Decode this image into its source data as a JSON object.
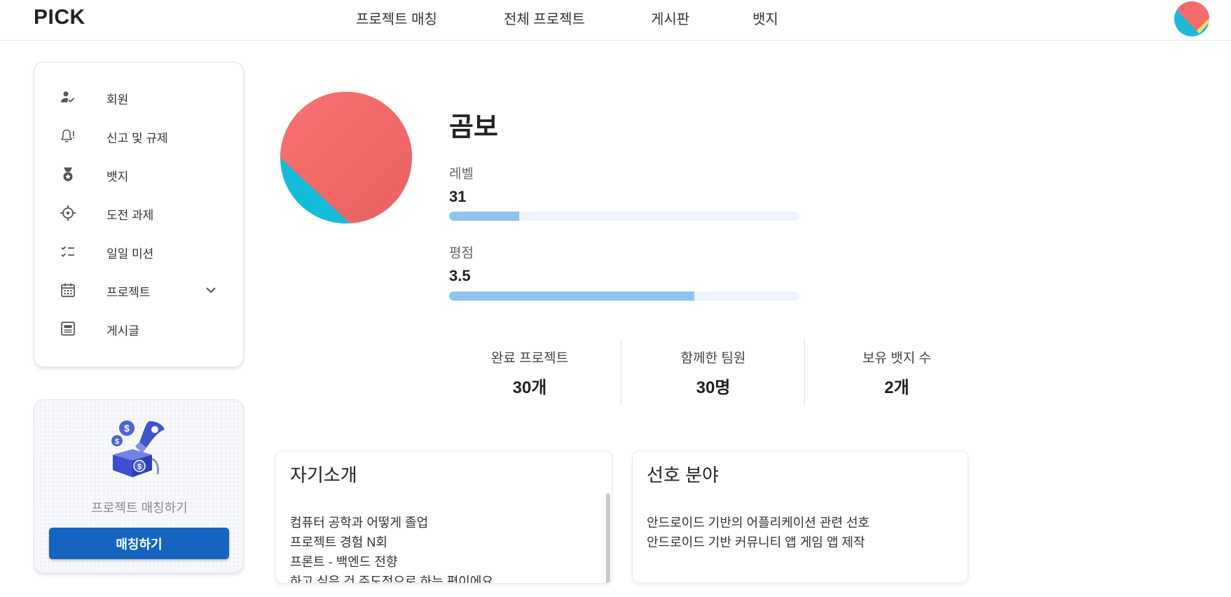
{
  "header": {
    "logo": "PICK",
    "nav": [
      "프로젝트 매칭",
      "전체 프로젝트",
      "게시판",
      "뱃지"
    ]
  },
  "sidebar": {
    "items": [
      {
        "label": "회원",
        "icon": "person-check-icon"
      },
      {
        "label": "신고 및 규제",
        "icon": "bell-alert-icon"
      },
      {
        "label": "뱃지",
        "icon": "medal-icon"
      },
      {
        "label": "도전 과제",
        "icon": "crosshair-icon"
      },
      {
        "label": "일일 미션",
        "icon": "checklist-icon"
      },
      {
        "label": "프로젝트",
        "icon": "calendar-icon"
      },
      {
        "label": "게시글",
        "icon": "article-icon"
      }
    ]
  },
  "promo": {
    "text": "프로젝트 매칭하기",
    "button": "매칭하기"
  },
  "profile": {
    "name": "곰보",
    "level_label": "레벨",
    "level_value": "31",
    "level_progress": 0.2,
    "rating_label": "평점",
    "rating_value": "3.5",
    "rating_progress": 0.7
  },
  "counts": [
    {
      "label": "완료 프로젝트",
      "value": "30개"
    },
    {
      "label": "함께한 팀원",
      "value": "30명"
    },
    {
      "label": "보유 뱃지 수",
      "value": "2개"
    }
  ],
  "intro": {
    "title": "자기소개",
    "lines": [
      "컴퓨터 공학과 어떻게 졸업",
      "프로젝트 경험 N회",
      "프론트 - 백엔드 전향",
      "하고 싶은 건 주도적으로 하는 편이에요"
    ]
  },
  "preference": {
    "title": "선호 분야",
    "lines": [
      "안드로이드 기반의 어플리케이션 관련 선호",
      "안드로이드 기반 커뮤니티 앱 게임 앱 제작"
    ]
  },
  "colors": {
    "accent": "#1565c0",
    "progress": "#8fc2ef",
    "avatar_coral": "#f56b6b",
    "avatar_cyan": "#1fb8d8"
  }
}
